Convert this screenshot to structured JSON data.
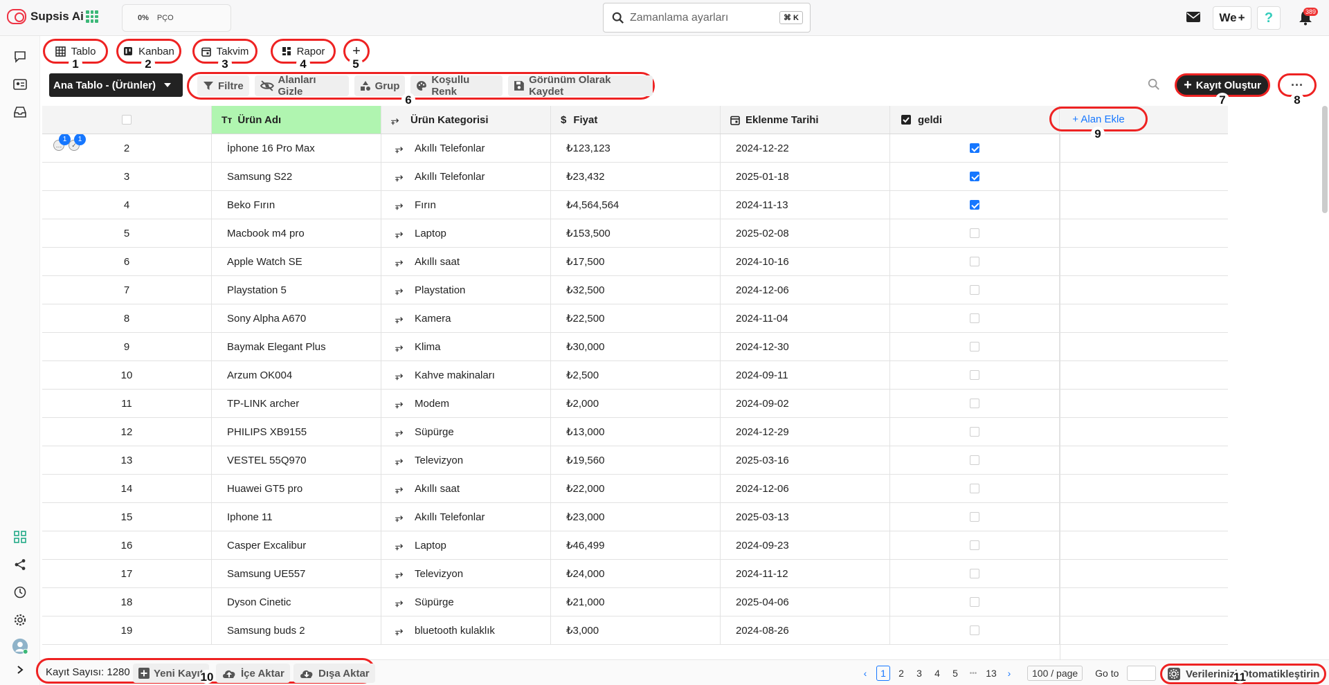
{
  "app": {
    "name": "Supsis Ai"
  },
  "progress": {
    "percent": "0%",
    "label": "PÇO"
  },
  "search": {
    "placeholder": "Zamanlama ayarları",
    "shortcut": "⌘ K"
  },
  "header_right": {
    "workspace": "We",
    "plus": "+",
    "help": "?",
    "notification_count": "389"
  },
  "views": {
    "tabs": [
      {
        "label": "Tablo",
        "marker": "1"
      },
      {
        "label": "Kanban",
        "marker": "2"
      },
      {
        "label": "Takvim",
        "marker": "3"
      },
      {
        "label": "Rapor",
        "marker": "4"
      }
    ],
    "add_marker": "5",
    "add_label": "+"
  },
  "table_selector": {
    "label": "Ana Tablo - (Ürünler)"
  },
  "toolbar": {
    "filter": "Filtre",
    "hide_fields": "Alanları Gizle",
    "group": "Grup",
    "conditional_color": "Koşullu Renk",
    "save_view": "Görünüm Olarak Kaydet",
    "marker": "6",
    "create_record": "Kayıt Oluştur",
    "create_marker": "7",
    "more": "···",
    "more_marker": "8"
  },
  "columns": {
    "name": "Ürün Adı",
    "category": "Ürün Kategorisi",
    "price": "Fiyat",
    "date": "Eklenme Tarihi",
    "geldi": "geldi",
    "add_field": "+ Alan Ekle",
    "add_field_marker": "9"
  },
  "row_badges": {
    "comments": "1",
    "tasks": "1"
  },
  "rows": [
    {
      "id": "2",
      "name": "İphone 16 Pro Max",
      "category": "Akıllı Telefonlar",
      "price": "₺123,123",
      "date": "2024-12-22",
      "geldi": true
    },
    {
      "id": "3",
      "name": "Samsung S22",
      "category": "Akıllı Telefonlar",
      "price": "₺23,432",
      "date": "2025-01-18",
      "geldi": true
    },
    {
      "id": "4",
      "name": "Beko Fırın",
      "category": "Fırın",
      "price": "₺4,564,564",
      "date": "2024-11-13",
      "geldi": true
    },
    {
      "id": "5",
      "name": "Macbook m4 pro",
      "category": "Laptop",
      "price": "₺153,500",
      "date": "2025-02-08",
      "geldi": false
    },
    {
      "id": "6",
      "name": "Apple Watch SE",
      "category": "Akıllı saat",
      "price": "₺17,500",
      "date": "2024-10-16",
      "geldi": false
    },
    {
      "id": "7",
      "name": "Playstation 5",
      "category": "Playstation",
      "price": "₺32,500",
      "date": "2024-12-06",
      "geldi": false
    },
    {
      "id": "8",
      "name": "Sony Alpha A670",
      "category": "Kamera",
      "price": "₺22,500",
      "date": "2024-11-04",
      "geldi": false
    },
    {
      "id": "9",
      "name": "Baymak Elegant Plus",
      "category": "Klima",
      "price": "₺30,000",
      "date": "2024-12-30",
      "geldi": false
    },
    {
      "id": "10",
      "name": "Arzum OK004",
      "category": "Kahve makinaları",
      "price": "₺2,500",
      "date": "2024-09-11",
      "geldi": false
    },
    {
      "id": "11",
      "name": "TP-LINK archer",
      "category": "Modem",
      "price": "₺2,000",
      "date": "2024-09-02",
      "geldi": false
    },
    {
      "id": "12",
      "name": "PHILIPS XB9155",
      "category": "Süpürge",
      "price": "₺13,000",
      "date": "2024-12-29",
      "geldi": false
    },
    {
      "id": "13",
      "name": "VESTEL 55Q970",
      "category": "Televizyon",
      "price": "₺19,560",
      "date": "2025-03-16",
      "geldi": false
    },
    {
      "id": "14",
      "name": "Huawei GT5 pro",
      "category": "Akıllı saat",
      "price": "₺22,000",
      "date": "2024-12-06",
      "geldi": false
    },
    {
      "id": "15",
      "name": "Iphone 11",
      "category": "Akıllı Telefonlar",
      "price": "₺23,000",
      "date": "2025-03-13",
      "geldi": false
    },
    {
      "id": "16",
      "name": "Casper Excalibur",
      "category": "Laptop",
      "price": "₺46,499",
      "date": "2024-09-23",
      "geldi": false
    },
    {
      "id": "17",
      "name": "Samsung UE557",
      "category": "Televizyon",
      "price": "₺24,000",
      "date": "2024-11-12",
      "geldi": false
    },
    {
      "id": "18",
      "name": "Dyson Cinetic",
      "category": "Süpürge",
      "price": "₺21,000",
      "date": "2025-04-06",
      "geldi": false
    },
    {
      "id": "19",
      "name": "Samsung buds 2",
      "category": "bluetooth kulaklık",
      "price": "₺3,000",
      "date": "2024-08-26",
      "geldi": false
    }
  ],
  "footer": {
    "count_label": "Kayıt Sayısı: 1280",
    "new_record": "Yeni Kayıt",
    "import": "İçe Aktar",
    "export": "Dışa Aktar",
    "marker": "10",
    "pages": [
      "1",
      "2",
      "3",
      "4",
      "5"
    ],
    "ellipsis": "•••",
    "last_page": "13",
    "page_size": "100 / page",
    "goto": "Go to",
    "automate": "Verilerinizi Otomatikleştirin",
    "automate_marker": "11"
  }
}
